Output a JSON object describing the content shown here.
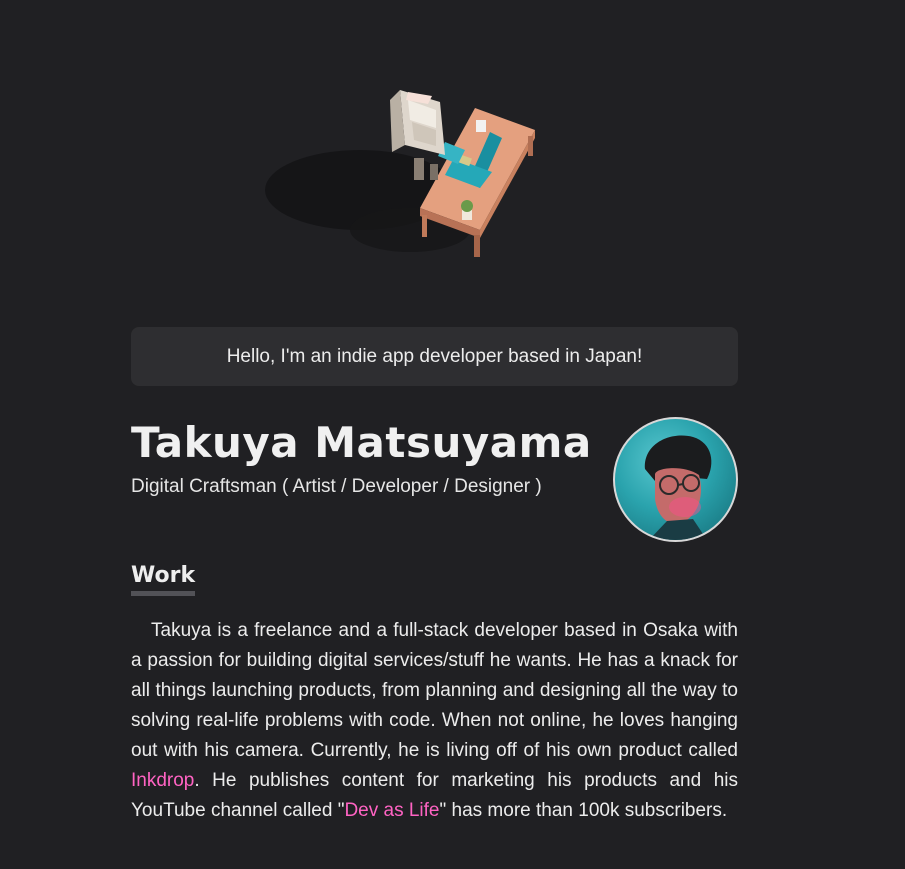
{
  "hero": {
    "image": "voxel-desk-illustration"
  },
  "greeting": {
    "text": "Hello, I'm an indie app developer based in Japan!"
  },
  "profile": {
    "name": "Takuya Matsuyama",
    "role": "Digital Craftsman ( Artist / Developer / Designer )",
    "avatar": "profile-photo"
  },
  "work": {
    "title": "Work",
    "text_1": "Takuya is a freelance and a full-stack developer based in Osaka with a passion for building digital services/stuff he wants. He has a knack for all things launching products, from planning and designing all the way to solving real-life problems with code. When not online, he loves hanging out with his camera. Currently, he is living off of his own product called ",
    "link_1": "Inkdrop",
    "text_2": ". He publishes content for marketing his products and his YouTube channel called \"",
    "link_2": "Dev as Life",
    "text_3": "\" has more than 100k subscribers."
  },
  "colors": {
    "background": "#202023",
    "card": "#2e2e31",
    "link": "#ff63c3"
  }
}
